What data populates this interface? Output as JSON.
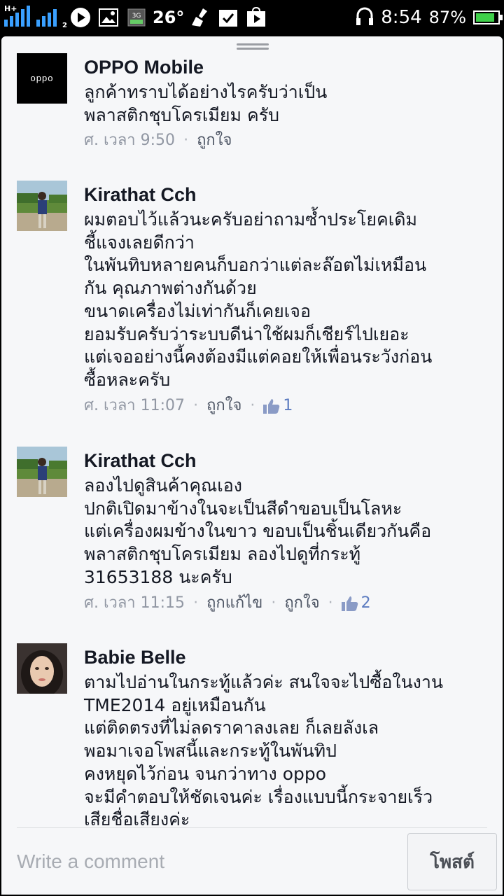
{
  "status_bar": {
    "network1": "H+",
    "network2": "2",
    "network3": "3G",
    "temperature": "26°",
    "time": "8:54",
    "battery": "87%",
    "battery_level": 0.87,
    "icons": [
      "signal-icon",
      "signal-icon",
      "play-icon",
      "image-icon",
      "3g-icon",
      "temperature-icon",
      "cleaner-icon",
      "check-icon",
      "play-store-icon",
      "headphones-icon",
      "battery-icon"
    ]
  },
  "comments": [
    {
      "name": "OPPO Mobile",
      "avatar_text": "oppo",
      "text": "ลูกค้าทราบได้อย่างไรครับว่าเป็น\nพลาสติกชุบโครเมียม ครับ",
      "time": "ศ. เวลา 9:50",
      "like_label": "ถูกใจ"
    },
    {
      "name": "Kirathat Cch",
      "text": "ผมตอบไว้แล้วนะครับอย่าถามซ้ำประโยคเดิม\nชี้แจงเลยดีกว่า\nในพันทิบหลายคนก็บอกว่าแต่ละล๊อตไม่เหมือน\nกัน คุณภาพต่างกันด้วย\nขนาดเครื่องไม่เท่ากันก็เคยเจอ\nยอมรับครับว่าระบบดีน่าใช้ผมก็เชียร์ไปเยอะ\nแต่เจออย่างนี้คงต้องมีแต่คอยให้เพื่อนระวังก่อน\nซื้อหละครับ",
      "time": "ศ. เวลา 11:07",
      "like_label": "ถูกใจ",
      "like_count": "1"
    },
    {
      "name": "Kirathat Cch",
      "text": "ลองไปดูสินค้าคุณเอง\nปกติเปิดมาข้างในจะเป็นสีดำขอบเป็นโลหะ\nแต่เครื่องผมข้างในขาว ขอบเป็นชิ้นเดียวกันคือ\nพลาสติกชุบโครเมียม ลองไปดูที่กระทู้\n31653188 นะครับ",
      "time": "ศ. เวลา 11:15",
      "edit_label": "ถูกแก้ไข",
      "like_label": "ถูกใจ",
      "like_count": "2"
    },
    {
      "name": "Babie Belle",
      "text": "ตามไปอ่านในกระทู้แล้วค่ะ สนใจจะไปซื้อในงาน\nTME2014 อยู่เหมือนกัน\nแต่ติดตรงที่ไม่ลดราคาลงเลย ก็เลยลังเล\nพอมาเจอโพสนี้และกระทู้ในพันทิป\nคงหยุดไว้ก่อน จนกว่าทาง oppo\nจะมีคำตอบให้ชัดเจนค่ะ เรื่องแบบนี้กระจายเร็ว\nเสียชื่อเสียงค่ะ"
    }
  ],
  "composer": {
    "placeholder": "Write a comment",
    "post_label": "โพสต์"
  },
  "colors": {
    "accent_blue": "#5b7bc0",
    "meta_gray": "#9197a3",
    "text_dark": "#141823",
    "background": "#f6f7f9"
  }
}
